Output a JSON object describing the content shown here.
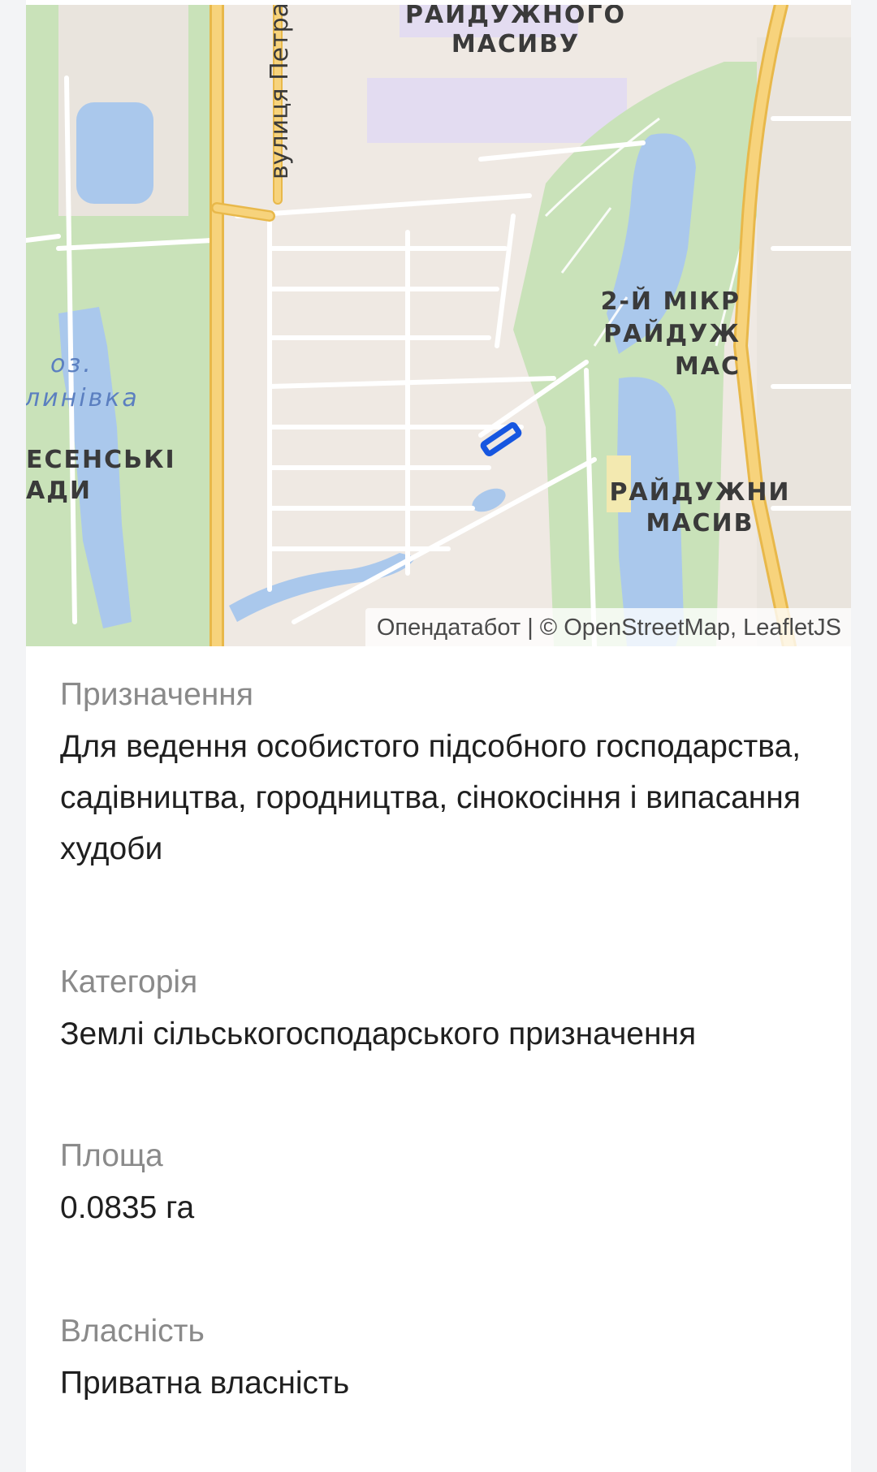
{
  "map": {
    "labels": {
      "district_top_1": "РАЙДУЖНОГО",
      "district_top_2": "МАСИВУ",
      "street": "вулиця Петра",
      "lake_1": "оз.",
      "lake_2": "линівка",
      "area_left_1": "ЕСЕНСЬКІ",
      "area_left_2": "АДИ",
      "district_right_1": "2-Й МІКР",
      "district_right_2": "РАЙДУЖ",
      "district_right_3": "МАС",
      "district_bottom_1": "РАЙДУЖНИ",
      "district_bottom_2": "МАСИВ"
    },
    "attribution": "Опендатабот | © OpenStreetMap, LeafletJS",
    "colors": {
      "land": "#efe9e3",
      "water": "#aac8ec",
      "park": "#c9e2b9",
      "road_major": "#f7d37c",
      "parcel": "#1656e0"
    }
  },
  "fields": [
    {
      "label": "Призначення",
      "value": "Для ведення особистого підсобного господарства, садівництва, городництва, сінокосіння і випасання худоби"
    },
    {
      "label": "Категорія",
      "value": "Землі сільськогосподарського призначення"
    },
    {
      "label": "Площа",
      "value": "0.0835 га"
    },
    {
      "label": "Власність",
      "value": "Приватна власність"
    }
  ]
}
